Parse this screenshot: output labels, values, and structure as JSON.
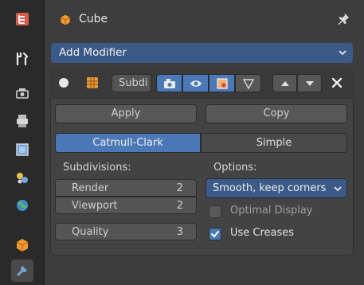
{
  "header": {
    "title": "Cube"
  },
  "add_modifier": {
    "label": "Add Modifier"
  },
  "modifier": {
    "name": "Subdi",
    "apply_label": "Apply",
    "copy_label": "Copy"
  },
  "mode_tabs": {
    "active": "Catmull-Clark",
    "inactive": "Simple"
  },
  "subdivisions": {
    "heading": "Subdivisions:",
    "render_label": "Render",
    "render_value": "2",
    "viewport_label": "Viewport",
    "viewport_value": "2",
    "quality_label": "Quality",
    "quality_value": "3"
  },
  "options": {
    "heading": "Options:",
    "uv_smooth": "Smooth, keep corners",
    "optimal_display_label": "Optimal Display",
    "optimal_display_checked": false,
    "use_creases_label": "Use Creases",
    "use_creases_checked": true
  },
  "colors": {
    "accent": "#4b78b6",
    "add_modifier_bg": "#3c5a87",
    "panel_bg": "#434343",
    "sidebar_bg": "#2a2a2a"
  },
  "icons": {
    "sidebar": [
      "tool-icon",
      "wrench-screwdriver-icon",
      "render-icon",
      "output-icon",
      "view-layer-icon",
      "scene-icon",
      "world-icon",
      "object-icon",
      "modifier-icon"
    ]
  }
}
